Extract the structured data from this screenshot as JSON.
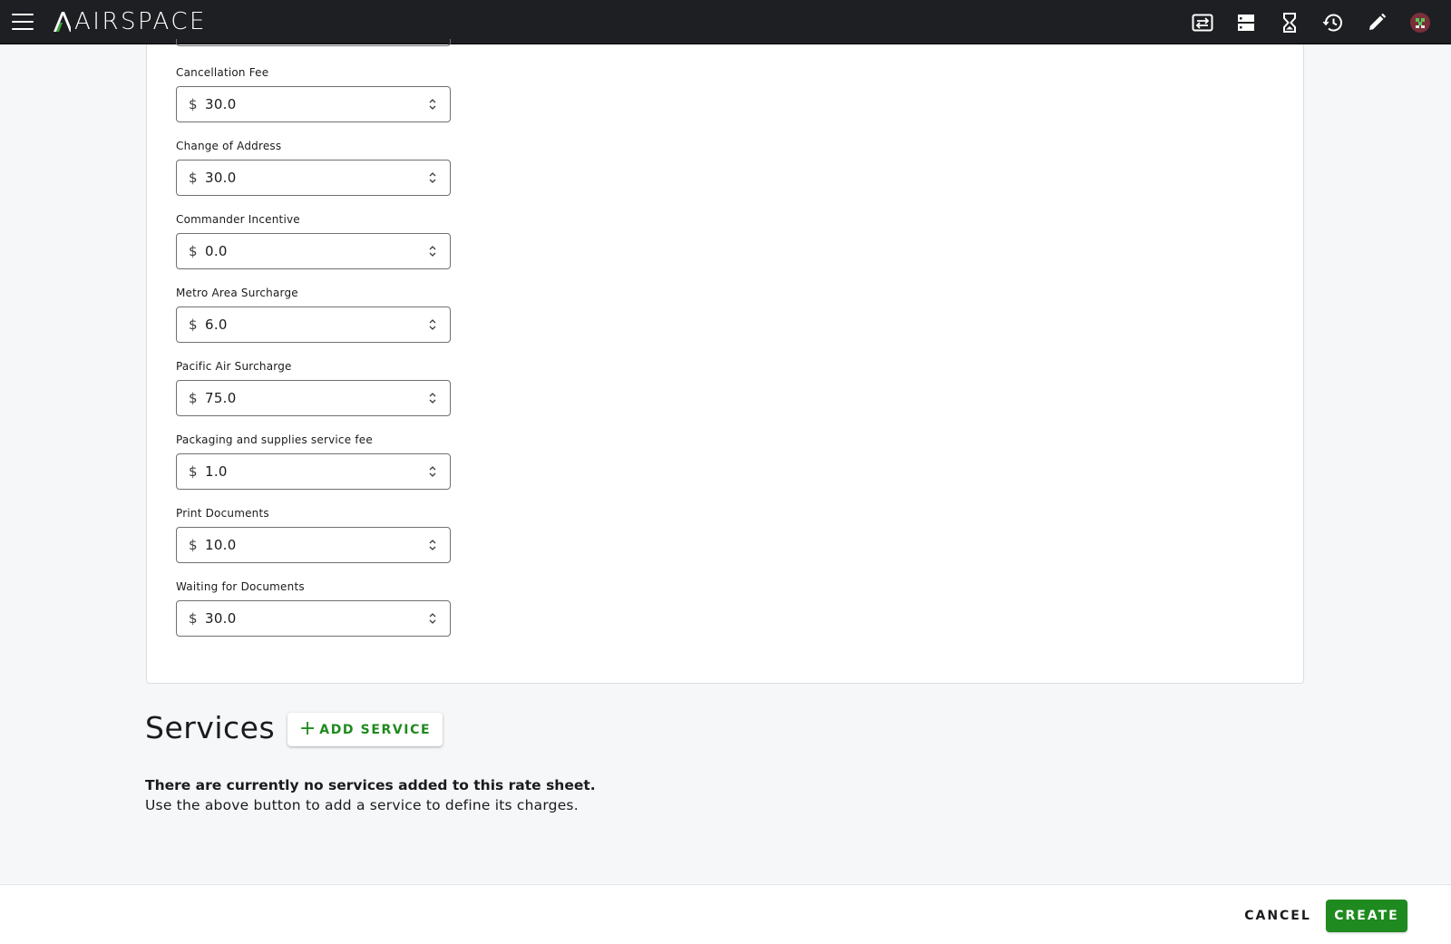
{
  "app": {
    "logo_text": "AIRSPACE"
  },
  "appbar": {
    "icons": [
      "swap-horizontal-icon",
      "storage-icon",
      "hourglass-icon",
      "history-icon",
      "pencil-icon",
      "avatar"
    ]
  },
  "fees": [
    {
      "label": "Cancellation Fee",
      "prefix": "$",
      "value": "30.0"
    },
    {
      "label": "Change of Address",
      "prefix": "$",
      "value": "30.0"
    },
    {
      "label": "Commander Incentive",
      "prefix": "$",
      "value": "0.0"
    },
    {
      "label": "Metro Area Surcharge",
      "prefix": "$",
      "value": "6.0"
    },
    {
      "label": "Pacific Air Surcharge",
      "prefix": "$",
      "value": "75.0"
    },
    {
      "label": "Packaging and supplies service fee",
      "prefix": "$",
      "value": "1.0"
    },
    {
      "label": "Print Documents",
      "prefix": "$",
      "value": "10.0"
    },
    {
      "label": "Waiting for Documents",
      "prefix": "$",
      "value": "30.0"
    }
  ],
  "services": {
    "title": "Services",
    "add_button_label": "ADD SERVICE",
    "add_button_icon": "+",
    "empty_title": "There are currently no services added to this rate sheet.",
    "empty_subtitle": "Use the above button to add a service to define its charges."
  },
  "footer": {
    "cancel_label": "CANCEL",
    "create_label": "CREATE"
  },
  "colors": {
    "appbar_bg": "#1e1f22",
    "accent_green": "#1f8a1f",
    "page_bg": "#f6f7f9"
  }
}
